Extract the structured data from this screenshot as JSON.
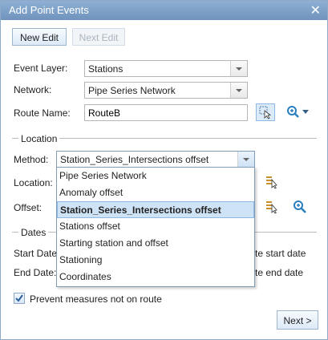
{
  "window": {
    "title": "Add Point Events",
    "close_glyph": "✕"
  },
  "toolbar": {
    "new_edit": "New Edit",
    "next_edit": "Next Edit"
  },
  "form": {
    "event_layer_label": "Event Layer:",
    "event_layer_value": "Stations",
    "network_label": "Network:",
    "network_value": "Pipe Series Network",
    "route_name_label": "Route Name:",
    "route_name_value": "RouteB"
  },
  "location": {
    "section_title": "Location",
    "method_label": "Method:",
    "method_value": "Station_Series_Intersections offset",
    "location_label": "Location:",
    "offset_label": "Offset:"
  },
  "dates": {
    "section_title": "Dates",
    "start_date_label": "Start Date",
    "end_date_label": "End Date:",
    "start_date_suffix": "te start date",
    "end_date_suffix": "te end date"
  },
  "method_options": [
    "Pipe Series Network",
    "Anomaly offset",
    "Station_Series_Intersections offset",
    "Stations offset",
    "Starting station and offset",
    "Stationing",
    "Coordinates"
  ],
  "selected_option_index": 2,
  "prevent_measures": {
    "label": "Prevent measures not on route",
    "checked": true
  },
  "footer": {
    "next_label": "Next >"
  },
  "colors": {
    "accent": "#6f93bd",
    "selection": "#cfe3f7",
    "zoom_icon": "#2a7fbf"
  }
}
